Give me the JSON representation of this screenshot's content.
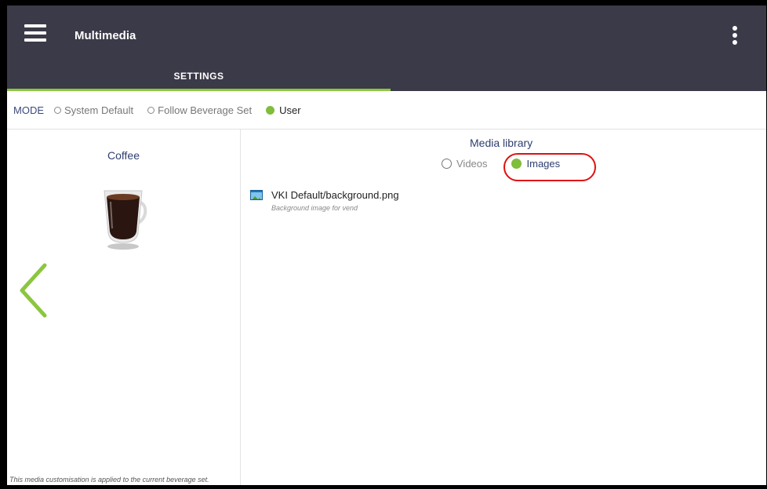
{
  "appbar": {
    "title": "Multimedia",
    "menu_icon": "hamburger-menu-icon",
    "more_icon": "more-vertical-icon"
  },
  "tabs": [
    {
      "label": "SETTINGS",
      "selected": true
    }
  ],
  "mode": {
    "label": "MODE",
    "options": [
      {
        "label": "System Default",
        "selected": false
      },
      {
        "label": "Follow Beverage Set",
        "selected": false
      },
      {
        "label": "User",
        "selected": true
      }
    ]
  },
  "beverage": {
    "name": "Coffee",
    "image_icon": "coffee-cup-icon",
    "back_icon": "chevron-left-icon"
  },
  "media_library": {
    "title": "Media library",
    "options": [
      {
        "label": "Videos",
        "selected": false
      },
      {
        "label": "Images",
        "selected": true
      }
    ],
    "items": [
      {
        "name": "VKI Default/background.png",
        "description": "Background image for vend",
        "icon": "image-file-icon"
      }
    ]
  },
  "footnote": "This media customisation is applied to the current beverage set.",
  "colors": {
    "appbar": "#3b3a48",
    "accent_green": "#8cc63f",
    "label_blue": "#2f3f70",
    "highlight_red": "#e01010"
  }
}
